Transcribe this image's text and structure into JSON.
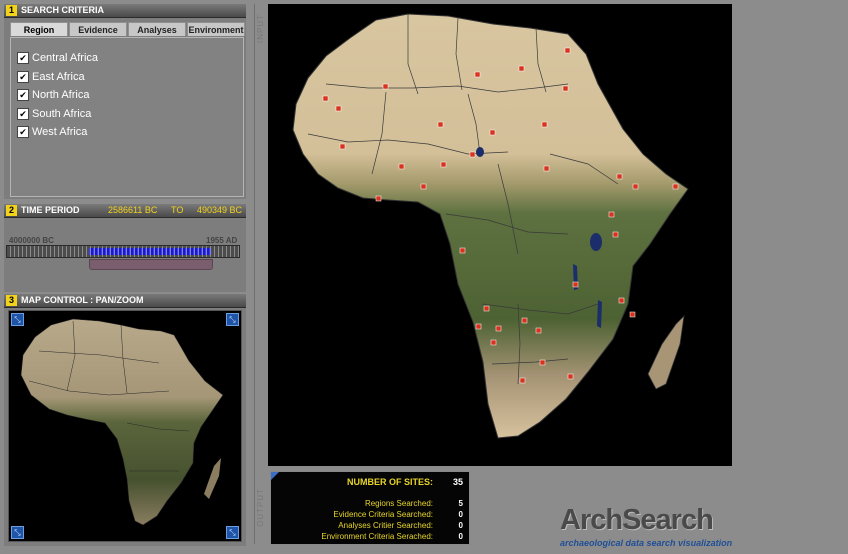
{
  "search_criteria": {
    "number": "1",
    "title": "SEARCH CRITERIA",
    "tabs": [
      {
        "label": "Region",
        "active": true
      },
      {
        "label": "Evidence",
        "active": false
      },
      {
        "label": "Analyses",
        "active": false
      },
      {
        "label": "Environment",
        "active": false
      }
    ],
    "regions": [
      {
        "label": "Central Africa",
        "checked": true
      },
      {
        "label": "East Africa",
        "checked": true
      },
      {
        "label": "North Africa",
        "checked": true
      },
      {
        "label": "South Africa",
        "checked": true
      },
      {
        "label": "West Africa",
        "checked": true
      }
    ],
    "check_glyph": "✔"
  },
  "time_period": {
    "number": "2",
    "title": "TIME PERIOD",
    "from": "2586611 BC",
    "to_label": "TO",
    "to": "490349 BC",
    "min_label": "4000000 BC",
    "max_label": "1955 AD",
    "selection_fraction": [
      0.354,
      0.878
    ]
  },
  "map_control": {
    "number": "3",
    "title": "MAP CONTROL : PAN/ZOOM",
    "corner_icon": "expand-arrow-icon",
    "corner_glyph": "⤡"
  },
  "side_labels": {
    "input": "INPUT",
    "output": "OUTPUT"
  },
  "output": {
    "sites_label": "NUMBER OF SITES:",
    "sites_value": "35",
    "rows": [
      {
        "label": "Regions Searched:",
        "value": "5"
      },
      {
        "label": "Evidence Criteria Searched:",
        "value": "0"
      },
      {
        "label": "Analyses Critier Searched:",
        "value": "0"
      },
      {
        "label": "Environment Criteria Serached:",
        "value": "0"
      }
    ]
  },
  "branding": {
    "logo": "ArchSearch",
    "tagline": "archaeological data search visualization"
  },
  "colors": {
    "accent_yellow": "#f2d21a",
    "slider_blue": "#2a2ae0",
    "site_marker": "#d8331f",
    "land_desert": "#d9c7a2",
    "land_forest": "#5b6b3a"
  }
}
